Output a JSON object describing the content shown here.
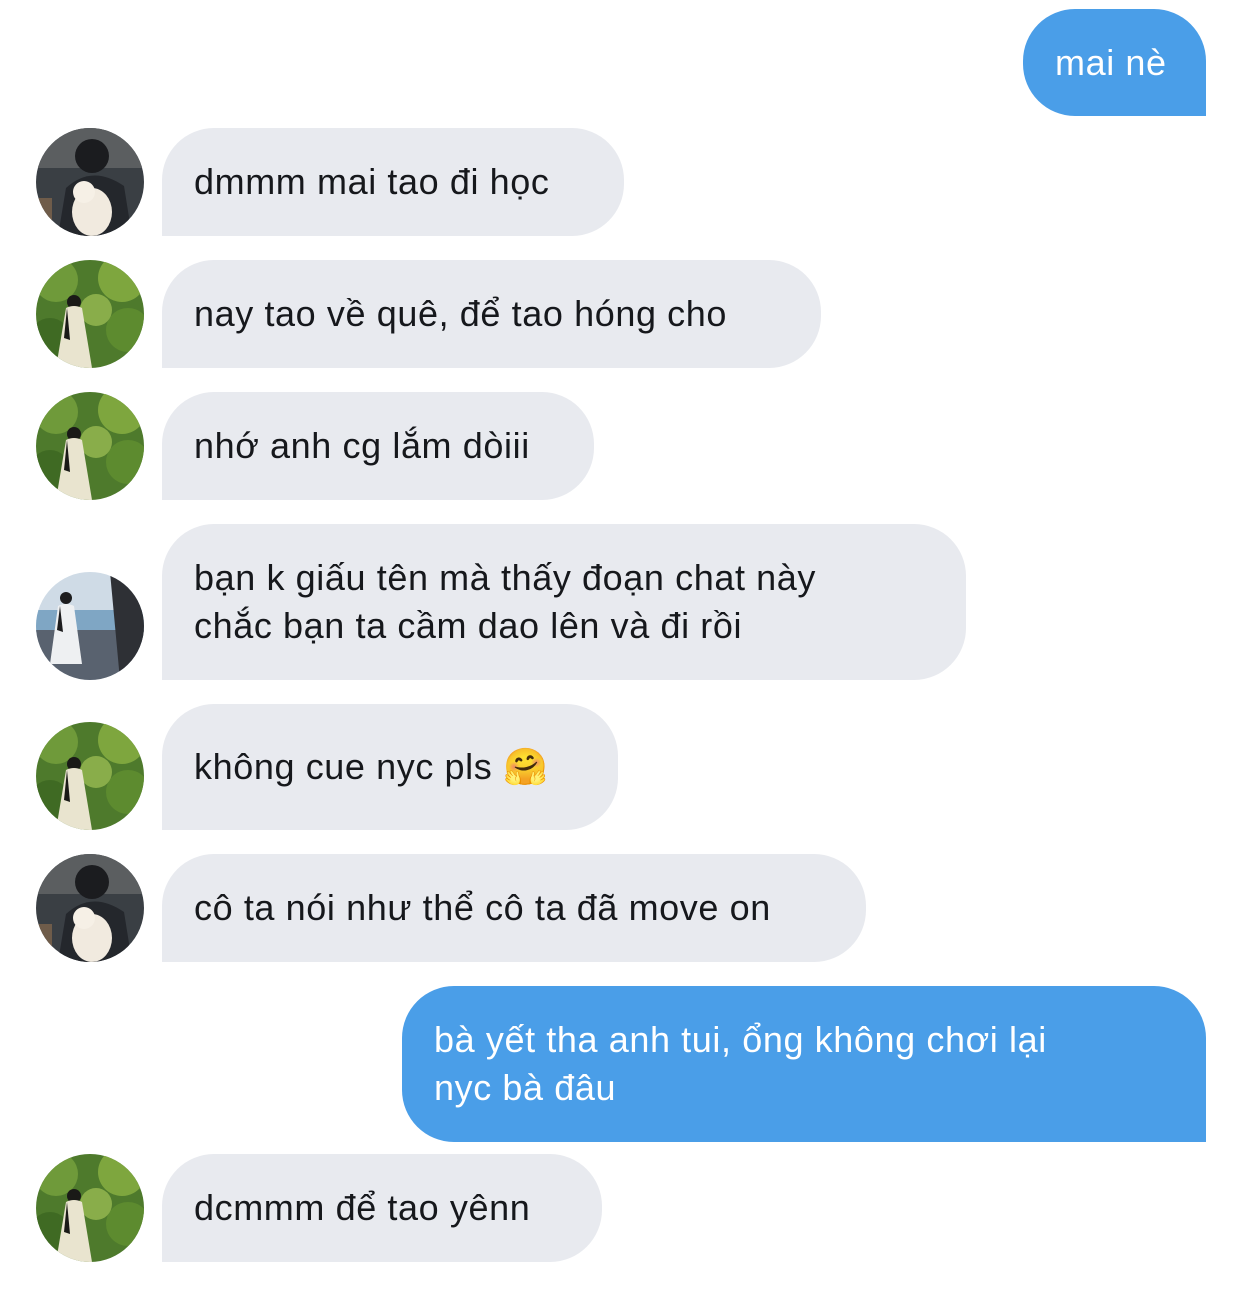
{
  "conversation": {
    "messages": [
      {
        "sender": "me",
        "text": "mai nè"
      },
      {
        "sender": "other",
        "avatar": "boy-with-dog-avatar",
        "text": "dmmm mai tao đi học"
      },
      {
        "sender": "other",
        "avatar": "girl-in-garden-avatar",
        "text": "nay tao về quê, để tao hóng cho"
      },
      {
        "sender": "other",
        "avatar": "girl-in-garden-avatar",
        "text": "nhớ anh cg lắm dòiii"
      },
      {
        "sender": "other",
        "avatar": "girl-by-sea-avatar",
        "line1": "bạn k giấu tên mà thấy đoạn chat này",
        "line2": "chắc bạn ta cầm dao lên và đi rồi"
      },
      {
        "sender": "other",
        "avatar": "girl-in-garden-avatar",
        "text": "không cue nyc pls",
        "emoji": "🤗",
        "emoji_name": "hugging-face-emoji"
      },
      {
        "sender": "other",
        "avatar": "boy-with-dog-avatar",
        "text": "cô ta nói như thể cô ta đã move on"
      },
      {
        "sender": "me",
        "line1": "bà yết tha anh tui, ổng không chơi lại",
        "line2": "nyc bà đâu"
      },
      {
        "sender": "other",
        "avatar": "girl-in-garden-avatar",
        "text": "dcmmm để tao yênn"
      }
    ]
  },
  "colors": {
    "outgoing_bubble": "#4a9ee8",
    "incoming_bubble": "#e8eaef",
    "incoming_text": "#16181c",
    "outgoing_text": "#ffffff"
  }
}
